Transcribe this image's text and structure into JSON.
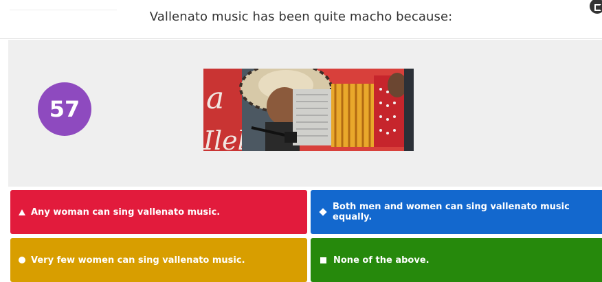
{
  "header": {
    "question": "Vallenato music has been quite macho because:",
    "corner_icon": "exit-icon"
  },
  "timer": {
    "value": "57"
  },
  "image": {
    "subject": "accordion player wearing a sombrero vueltiao"
  },
  "answers": [
    {
      "shape": "triangle-icon",
      "text": "Any woman can sing vallenato music.",
      "color": "#e21b3c"
    },
    {
      "shape": "diamond-icon",
      "text": "Both men and women can sing vallenato music equally.",
      "color": "#1368ce"
    },
    {
      "shape": "circle-icon",
      "text": "Very few women can sing vallenato music.",
      "color": "#d89e00"
    },
    {
      "shape": "square-icon",
      "text": "None of the above.",
      "color": "#26890c"
    }
  ],
  "colors": {
    "timer_bg": "#8e4abf",
    "stage_bg": "#efefef"
  }
}
